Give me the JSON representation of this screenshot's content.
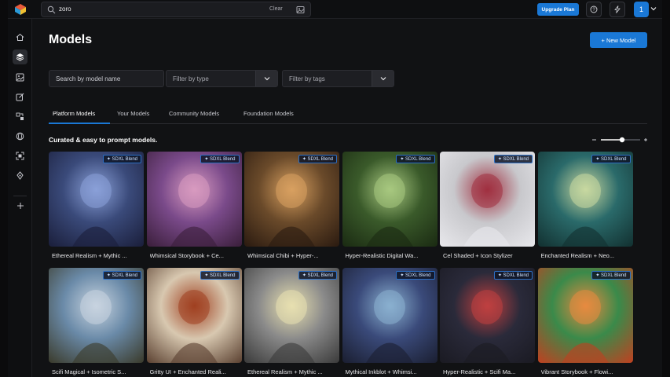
{
  "search": {
    "value": "zoro",
    "clear_label": "Clear"
  },
  "header": {
    "upgrade_label": "Upgrade Plan",
    "avatar_initial": "1"
  },
  "page": {
    "title": "Models",
    "new_model_label": "+ New Model"
  },
  "filters": {
    "model_name_placeholder": "Search by model name",
    "type_placeholder": "Filter by type",
    "tags_placeholder": "Filter by tags"
  },
  "tabs": [
    {
      "label": "Platform Models",
      "active": true
    },
    {
      "label": "Your Models",
      "active": false
    },
    {
      "label": "Community Models",
      "active": false
    },
    {
      "label": "Foundation Models",
      "active": false
    }
  ],
  "section": {
    "subtitle": "Curated & easy to prompt models."
  },
  "badge_label": "✦ SDXL Blend",
  "cards": [
    {
      "name": "Ethereal Realism + Mythic ...",
      "palette": [
        "#3a4a7a",
        "#8aa0d8",
        "#1a1e3a"
      ]
    },
    {
      "name": "Whimsical Storybook + Ce...",
      "palette": [
        "#7a4a8a",
        "#d89ac0",
        "#3a1e3a"
      ]
    },
    {
      "name": "Whimsical Chibi + Hyper-...",
      "palette": [
        "#6a4a2a",
        "#d8a060",
        "#2a1a10"
      ]
    },
    {
      "name": "Hyper-Realistic Digital Wa...",
      "palette": [
        "#3a5a2a",
        "#a8c880",
        "#1a2a12"
      ]
    },
    {
      "name": "Cel Shaded + Icon Stylizer",
      "palette": [
        "#c8c8cc",
        "#a03040",
        "#e8e8ec"
      ]
    },
    {
      "name": "Enchanted Realism + Neo...",
      "palette": [
        "#2a6a6a",
        "#c8d8a0",
        "#123030"
      ]
    },
    {
      "name": "Scifi Magical + Isometric S...",
      "palette": [
        "#6a8aa8",
        "#c8d4e0",
        "#3a3a2a"
      ]
    },
    {
      "name": "Gritty UI + Enchanted Reali...",
      "palette": [
        "#d8c8b0",
        "#a04020",
        "#5a4030"
      ]
    },
    {
      "name": "Ethereal Realism + Mythic ...",
      "palette": [
        "#8a8a8a",
        "#e8e0b0",
        "#3a3a3a"
      ]
    },
    {
      "name": "Mythical Inkblot + Whimsi...",
      "palette": [
        "#3a4a7a",
        "#8ab0d0",
        "#1a1e30"
      ]
    },
    {
      "name": "Hyper-Realistic + Scifi Ma...",
      "palette": [
        "#2a2a3a",
        "#c04040",
        "#1a1a22"
      ]
    },
    {
      "name": "Vibrant Storybook + Flowi...",
      "palette": [
        "#3a8a4a",
        "#e88a40",
        "#c04020"
      ]
    }
  ]
}
